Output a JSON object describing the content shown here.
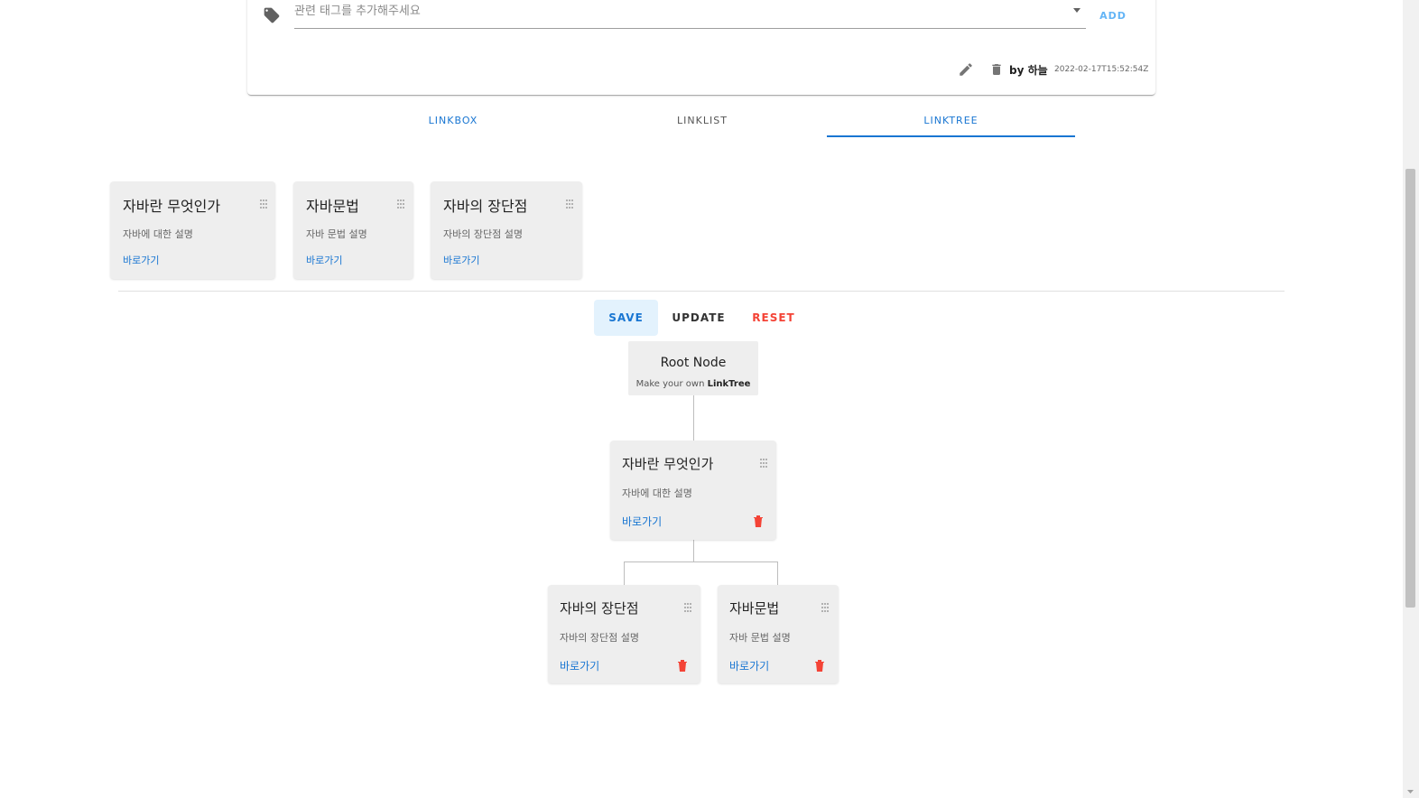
{
  "tag_bar": {
    "placeholder": "관련 태그를 추가해주세요",
    "add_label": "ADD"
  },
  "meta": {
    "author": "by 하늘",
    "timestamp": "2022-02-17T15:52:54Z"
  },
  "tabs": [
    {
      "label": "LINKBOX"
    },
    {
      "label": "LINKLIST"
    },
    {
      "label": "LINKTREE",
      "active": true
    }
  ],
  "palette": [
    {
      "title": "자바란 무엇인가",
      "desc": "자바에 대한 설명",
      "link": "바로가기"
    },
    {
      "title": "자바문법",
      "desc": "자바 문법 설명",
      "link": "바로가기"
    },
    {
      "title": "자바의 장단점",
      "desc": "자바의 장단점 설명",
      "link": "바로가기"
    }
  ],
  "actions": {
    "save": "SAVE",
    "update": "UPDATE",
    "reset": "RESET"
  },
  "tree": {
    "root": {
      "title": "Root Node",
      "sub_prefix": "Make your own ",
      "sub_bold": "LinkTree"
    },
    "level1": {
      "title": "자바란 무엇인가",
      "desc": "자바에 대한 설명",
      "link": "바로가기"
    },
    "level2": [
      {
        "title": "자바의 장단점",
        "desc": "자바의 장단점 설명",
        "link": "바로가기"
      },
      {
        "title": "자바문법",
        "desc": "자바 문법 설명",
        "link": "바로가기"
      }
    ]
  },
  "colors": {
    "accent": "#1976d2",
    "danger": "#f44336",
    "card_bg": "#eeeeee"
  }
}
